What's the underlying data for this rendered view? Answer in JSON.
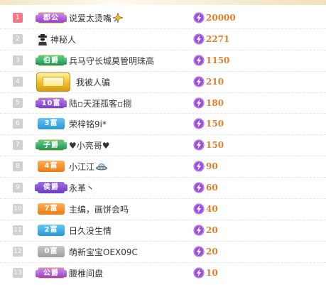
{
  "leaderboard": {
    "rows": [
      {
        "rank": "1",
        "badge": "郡公",
        "badge_style": "purple",
        "name": "说爱太烫嘴",
        "name_icon": "sparkle-icon",
        "score": "20000"
      },
      {
        "rank": "2",
        "badge": "",
        "badge_style": "avatar",
        "name": "神秘人",
        "name_icon": "",
        "score": "2271"
      },
      {
        "rank": "3",
        "badge": "伯爵",
        "badge_style": "green",
        "name": "兵马守长城莫管明珠高",
        "name_icon": "",
        "score": "1150"
      },
      {
        "rank": "4",
        "badge": "",
        "badge_style": "big-gold",
        "name": "我被人骗",
        "name_icon": "",
        "score": "210"
      },
      {
        "rank": "5",
        "badge": "10富",
        "badge_style": "purple2",
        "name": "陆▫天涯孤客▫捌",
        "name_icon": "",
        "score": "180"
      },
      {
        "rank": "6",
        "badge": "3富",
        "badge_style": "blue",
        "name": "荣梓铭9i*",
        "name_icon": "",
        "score": "150"
      },
      {
        "rank": "7",
        "badge": "子爵",
        "badge_style": "green",
        "name": "♥小亮哥♥",
        "name_icon": "",
        "score": "150"
      },
      {
        "rank": "8",
        "badge": "4富",
        "badge_style": "orange",
        "name": "小江江",
        "name_icon": "ufo-icon",
        "score": "90"
      },
      {
        "rank": "9",
        "badge": "侯爵",
        "badge_style": "violet",
        "name": "永革丶",
        "name_icon": "",
        "score": "60"
      },
      {
        "rank": "10",
        "badge": "7富",
        "badge_style": "orange",
        "name": "主编，画饼会吗",
        "name_icon": "",
        "score": "40"
      },
      {
        "rank": "11",
        "badge": "2富",
        "badge_style": "blue",
        "name": "日久没生情",
        "name_icon": "",
        "score": "20"
      },
      {
        "rank": "12",
        "badge": "0富",
        "badge_style": "gray",
        "name": "萌新宝宝OEX09C",
        "name_icon": "",
        "score": "20"
      },
      {
        "rank": "13",
        "badge": "公爵",
        "badge_style": "purple",
        "name": "腰椎间盘",
        "name_icon": "",
        "score": "10"
      }
    ]
  },
  "colors": {
    "score": "#e07f28",
    "rank_first": "#f07b87",
    "rank_default": "#d0d0d0",
    "bolt_circle": "#9b4fd6"
  },
  "icons": {
    "score_icon": "lightning-bolt-icon",
    "rank_marker": "rank-number-box"
  }
}
